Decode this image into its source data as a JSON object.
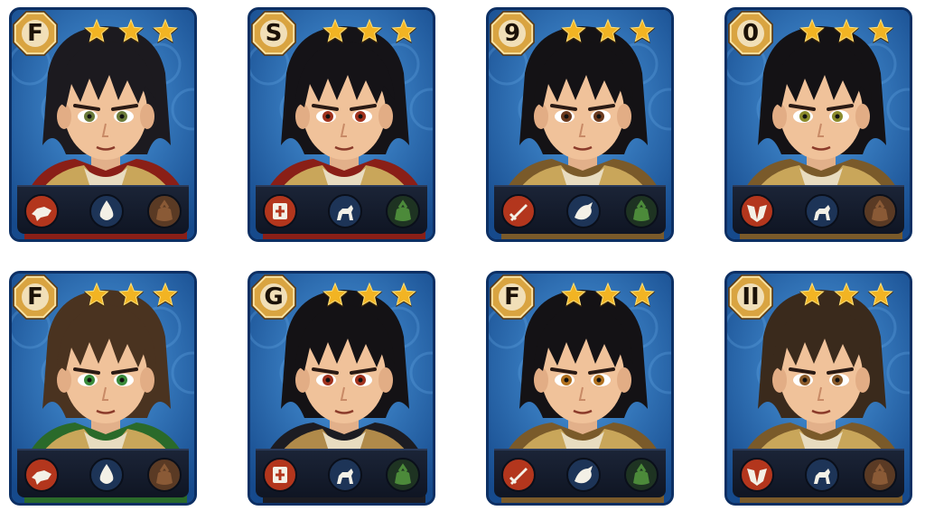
{
  "cards": [
    {
      "rank": "F",
      "stars": 3,
      "hair": "#1c1a1f",
      "eye": "#6a7a3a",
      "armor": "red",
      "skills": [
        "chick-fist-icon",
        "water-drop-icon",
        "bag-icon"
      ]
    },
    {
      "rank": "S",
      "stars": 3,
      "hair": "#151317",
      "eye": "#a0321e",
      "armor": "red",
      "skills": [
        "shield-cross-icon",
        "horse-rider-icon",
        "green-bag-icon"
      ]
    },
    {
      "rank": "9",
      "stars": 3,
      "hair": "#141215",
      "eye": "#6b3a1e",
      "armor": "gold",
      "skills": [
        "sword-slash-icon",
        "dragon-icon",
        "green-bag-icon"
      ]
    },
    {
      "rank": "0",
      "stars": 3,
      "hair": "#141215",
      "eye": "#8a8a2a",
      "armor": "gold",
      "skills": [
        "wing-shield-icon",
        "horse-rider-icon",
        "bag-icon"
      ]
    },
    {
      "rank": "F",
      "stars": 3,
      "hair": "#4a3320",
      "eye": "#3a8a3a",
      "armor": "green",
      "skills": [
        "chick-fist-icon",
        "water-drop-icon",
        "bag-icon"
      ]
    },
    {
      "rank": "G",
      "stars": 3,
      "hair": "#141215",
      "eye": "#a0321e",
      "armor": "dark",
      "skills": [
        "shield-cross-icon",
        "horse-rider-icon",
        "green-bag-icon"
      ]
    },
    {
      "rank": "F",
      "stars": 3,
      "hair": "#141215",
      "eye": "#b0701e",
      "armor": "gold",
      "skills": [
        "sword-slash-icon",
        "dragon-icon",
        "green-bag-icon"
      ]
    },
    {
      "rank": "II",
      "stars": 3,
      "hair": "#3a2a1c",
      "eye": "#8a5a2a",
      "armor": "gold",
      "skills": [
        "wing-shield-icon",
        "horse-rider-icon",
        "bag-icon"
      ]
    }
  ],
  "colors": {
    "card_blue": "#1e5ea8",
    "badge_gold": "#d9a441",
    "star_gold": "#f2b423",
    "skill_red": "#b3361d",
    "skill_navy": "#1d3457",
    "skill_brown": "#5a3a24"
  }
}
